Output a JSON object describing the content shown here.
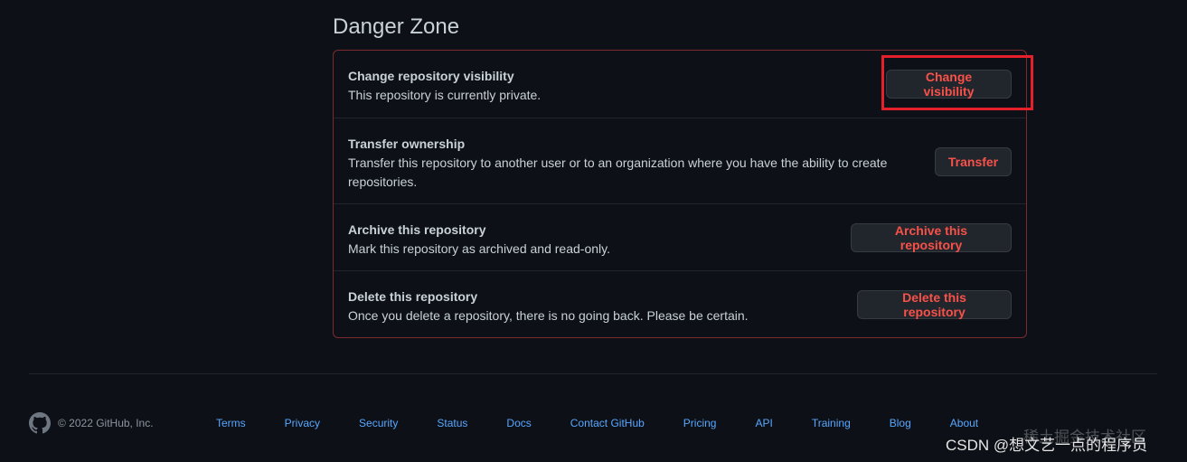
{
  "section": {
    "title": "Danger Zone"
  },
  "rows": [
    {
      "heading": "Change repository visibility",
      "description": "This repository is currently private.",
      "button": "Change visibility"
    },
    {
      "heading": "Transfer ownership",
      "description": "Transfer this repository to another user or to an organization where you have the ability to create repositories.",
      "button": "Transfer"
    },
    {
      "heading": "Archive this repository",
      "description": "Mark this repository as archived and read-only.",
      "button": "Archive this repository"
    },
    {
      "heading": "Delete this repository",
      "description": "Once you delete a repository, there is no going back. Please be certain.",
      "button": "Delete this repository"
    }
  ],
  "footer": {
    "logo_icon": "github-mark-icon",
    "copyright": "© 2022 GitHub, Inc.",
    "links": [
      "Terms",
      "Privacy",
      "Security",
      "Status",
      "Docs",
      "Contact GitHub",
      "Pricing",
      "API",
      "Training",
      "Blog",
      "About"
    ]
  },
  "watermark": {
    "text": "CSDN @想文艺一点的程序员",
    "faint_text": "稀土掘金技术社区"
  },
  "colors": {
    "background": "#0d1117",
    "danger_text": "#f85149",
    "danger_border": "#7d2a2e",
    "link": "#58a6ff",
    "annotation_red": "#e5202a"
  }
}
